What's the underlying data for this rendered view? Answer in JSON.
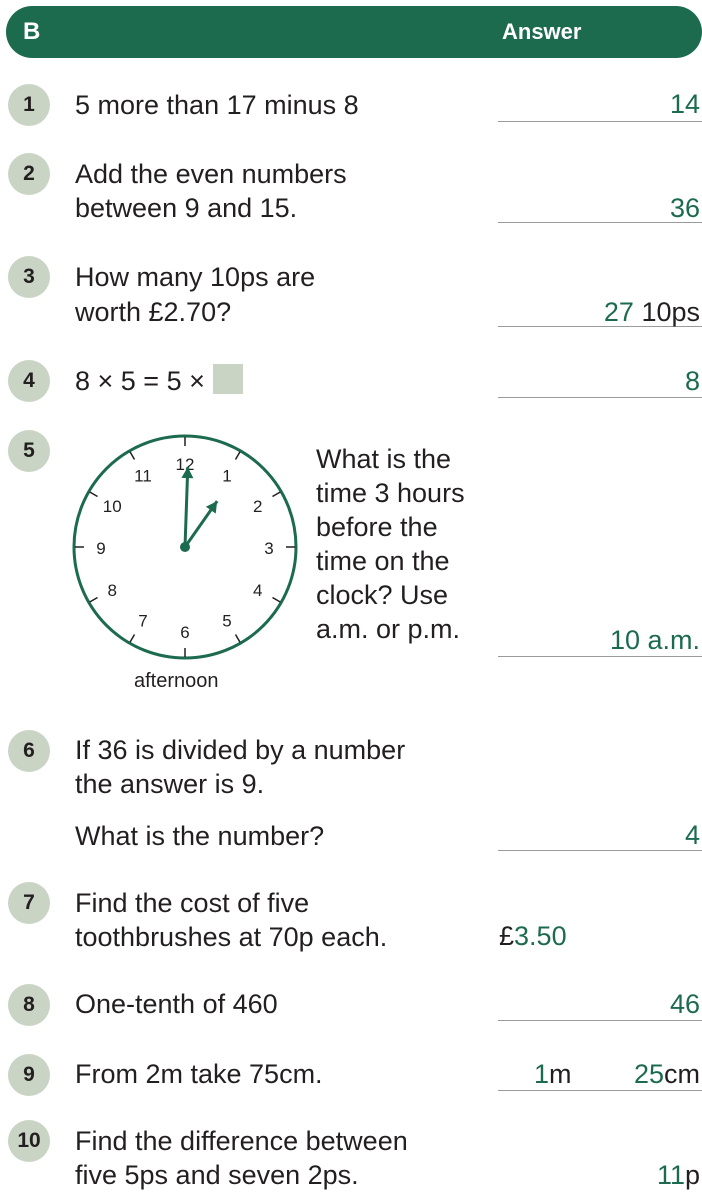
{
  "header": {
    "section": "B",
    "answer_label": "Answer"
  },
  "q1": {
    "num": "1",
    "text": "5 more than 17 minus 8",
    "answer": "14"
  },
  "q2": {
    "num": "2",
    "line1": "Add the even numbers",
    "line2": "between 9 and 15.",
    "answer": "36"
  },
  "q3": {
    "num": "3",
    "line1": "How many 10ps are",
    "line2": "worth £2.70?",
    "answer": "27",
    "unit": "10ps"
  },
  "q4": {
    "num": "4",
    "text": "8 × 5 = 5 ×",
    "answer": "8"
  },
  "q5": {
    "num": "5",
    "lines": [
      "What is the",
      "time 3 hours",
      "before the",
      "time on the",
      "clock? Use",
      "a.m. or p.m."
    ],
    "answer": "10 a.m.",
    "clock_caption": "afternoon",
    "clock": {
      "numbers": [
        "12",
        "1",
        "2",
        "3",
        "4",
        "5",
        "6",
        "7",
        "8",
        "9",
        "10",
        "11"
      ],
      "hour": 1,
      "minute": 0
    }
  },
  "q6": {
    "num": "6",
    "line1": "If 36 is divided by a number",
    "line2": "the answer is 9.",
    "line3": "What is the number?",
    "answer": "4"
  },
  "q7": {
    "num": "7",
    "line1": "Find the cost of five",
    "line2": "toothbrushes at 70p each.",
    "currency": "£",
    "answer": "3.50"
  },
  "q8": {
    "num": "8",
    "text": "One-tenth of 460",
    "answer": "46"
  },
  "q9": {
    "num": "9",
    "text": "From 2m take 75cm.",
    "answer_m": "1",
    "unit_m": "m",
    "answer_cm": "25",
    "unit_cm": "cm"
  },
  "q10": {
    "num": "10",
    "line1": "Find the difference between",
    "line2": "five 5ps and seven 2ps.",
    "answer": "11",
    "unit": "p"
  },
  "colors": {
    "green": "#1d6b4f",
    "circle": "#c9d4c5"
  }
}
